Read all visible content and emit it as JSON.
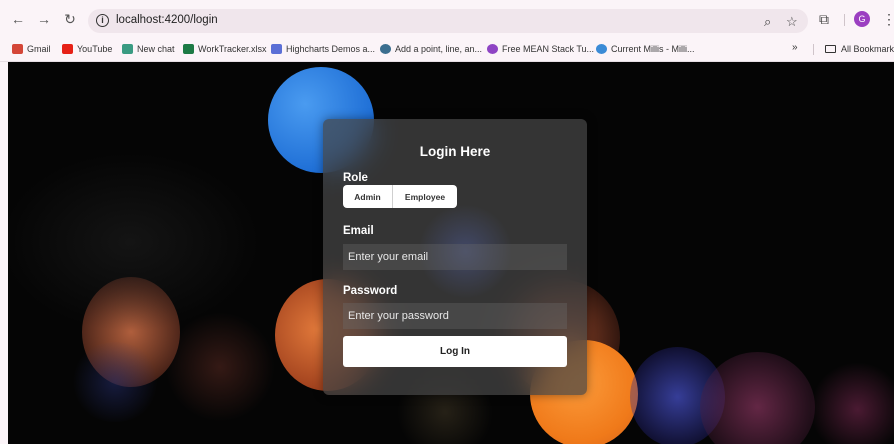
{
  "browser": {
    "url": "localhost:4200/login",
    "bookmarks": [
      {
        "label": "Gmail",
        "color": "#d44638"
      },
      {
        "label": "YouTube",
        "color": "#e62117"
      },
      {
        "label": "New chat",
        "color": "#3a9b82"
      },
      {
        "label": "WorkTracker.xlsx",
        "color": "#1d7a45"
      },
      {
        "label": "Highcharts Demos a...",
        "color": "#5b6fd6"
      },
      {
        "label": "Add a point, line, an...",
        "color": "#3b6e8f"
      },
      {
        "label": "Free MEAN Stack Tu...",
        "color": "#8e44c4"
      },
      {
        "label": "Current Millis - Milli...",
        "color": "#3b8bd6"
      }
    ],
    "all_bookmarks_label": "All Bookmarks",
    "profile_initial": "G"
  },
  "login": {
    "title": "Login Here",
    "role_label": "Role",
    "roles": [
      "Admin",
      "Employee"
    ],
    "email_label": "Email",
    "email_placeholder": "Enter your email",
    "password_label": "Password",
    "password_placeholder": "Enter your password",
    "submit_label": "Log In"
  }
}
